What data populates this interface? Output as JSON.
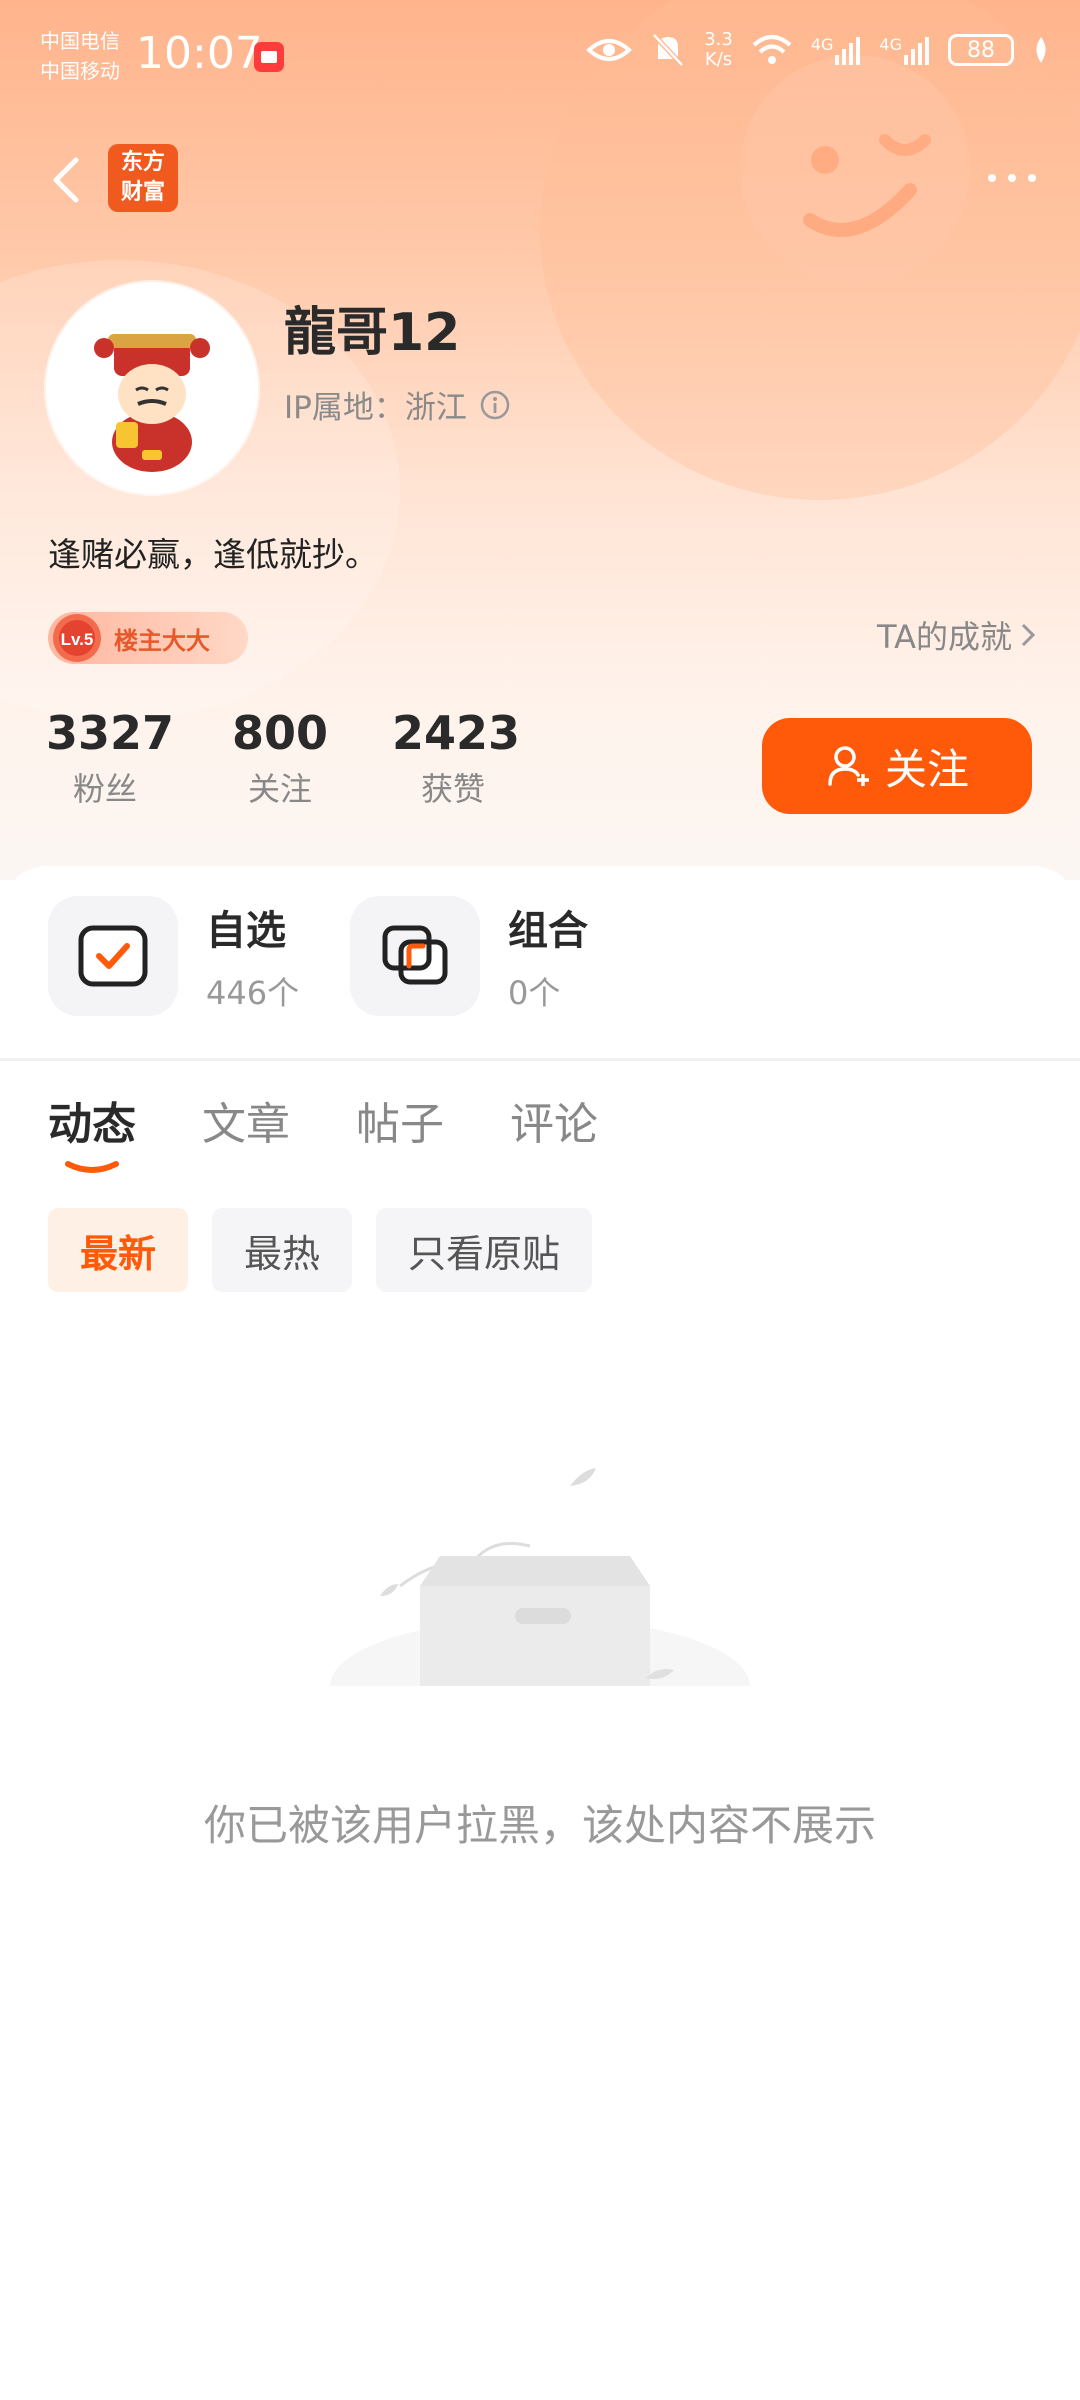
{
  "status_bar": {
    "carrier_1": "中国电信",
    "carrier_2": "中国移动",
    "time": "10:07",
    "net_speed_value": "3.3",
    "net_speed_unit": "K/s",
    "signal_1": "4G",
    "signal_2": "4G",
    "battery": "88"
  },
  "header": {
    "app_logo_line1": "东方",
    "app_logo_line2": "财富",
    "back_icon": "chevron-left-icon",
    "more_icon": "more-dots-icon"
  },
  "profile": {
    "username": "龍哥12",
    "ip_location": "IP属地：浙江",
    "bio": "逢赌必赢，逢低就抄。",
    "badge_level": "Lv.5",
    "badge_title": "楼主大大",
    "achievements_link": "TA的成就"
  },
  "stats": [
    {
      "value": "3327",
      "label": "粉丝"
    },
    {
      "value": "800",
      "label": "关注"
    },
    {
      "value": "2423",
      "label": "获赞"
    }
  ],
  "follow_button": "关注",
  "portfolio": [
    {
      "title": "自选",
      "count": "446个"
    },
    {
      "title": "组合",
      "count": "0个"
    }
  ],
  "tabs": [
    "动态",
    "文章",
    "帖子",
    "评论"
  ],
  "active_tab": "动态",
  "filters": [
    "最新",
    "最热",
    "只看原贴"
  ],
  "active_filter": "最新",
  "empty_message": "你已被该用户拉黑，该处内容不展示",
  "colors": {
    "accent": "#ff5a0a",
    "hero_top": "#ffb48c",
    "hero_bottom": "#fbf6f3"
  }
}
